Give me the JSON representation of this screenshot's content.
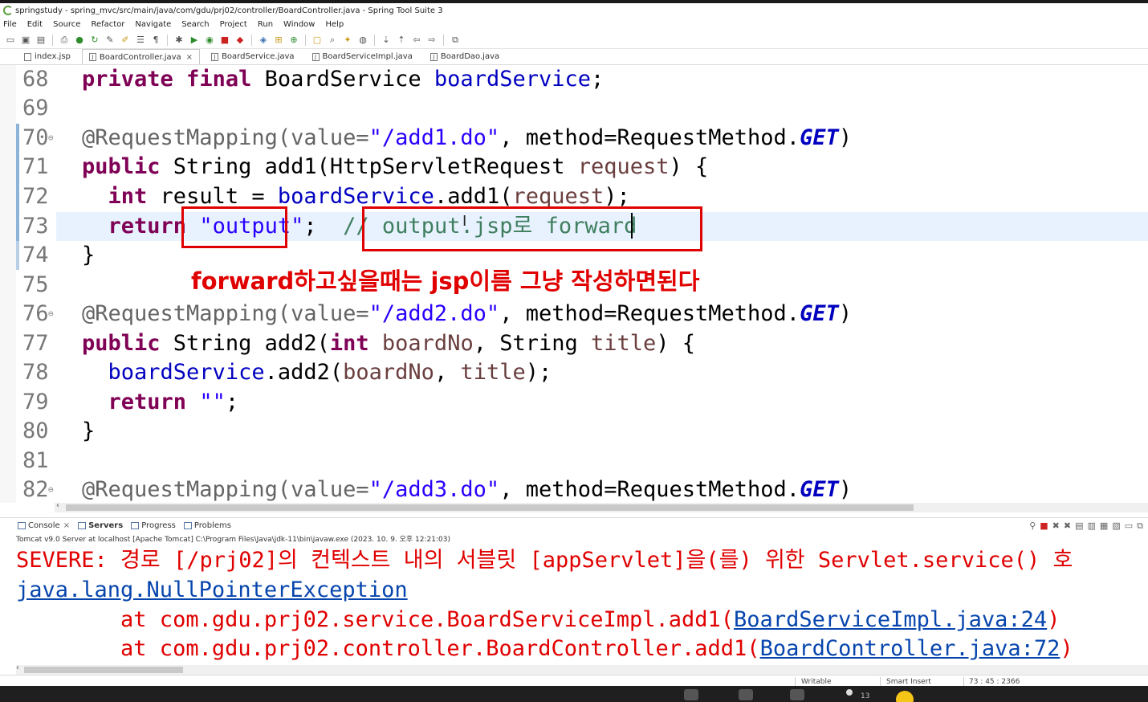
{
  "window": {
    "title": "springstudy - spring_mvc/src/main/java/com/gdu/prj02/controller/BoardController.java - Spring Tool Suite 3"
  },
  "menu": [
    "File",
    "Edit",
    "Source",
    "Refactor",
    "Navigate",
    "Search",
    "Project",
    "Run",
    "Window",
    "Help"
  ],
  "editor_tabs": [
    {
      "label": "index.jsp",
      "active": false
    },
    {
      "label": "BoardController.java",
      "active": true,
      "close": "×"
    },
    {
      "label": "BoardService.java",
      "active": false
    },
    {
      "label": "BoardServiceImpl.java",
      "active": false
    },
    {
      "label": "BoardDao.java",
      "active": false
    }
  ],
  "code_lines": [
    {
      "no": "68",
      "parts": [
        [
          "kw",
          "private"
        ],
        [
          "",
          "",
          " "
        ],
        [
          "kw",
          "final"
        ],
        [
          "",
          "",
          " "
        ]
      ]
    },
    {
      "no": "69"
    },
    {
      "no": "70"
    },
    {
      "no": "71"
    },
    {
      "no": "72"
    },
    {
      "no": "73"
    },
    {
      "no": "74"
    },
    {
      "no": "75"
    },
    {
      "no": "76"
    },
    {
      "no": "77"
    },
    {
      "no": "78"
    },
    {
      "no": "79"
    },
    {
      "no": "80"
    },
    {
      "no": "81"
    },
    {
      "no": "82"
    }
  ],
  "code": {
    "l68": {
      "a": "private",
      "b": "final",
      "c": " BoardService ",
      "d": "boardService",
      "e": ";"
    },
    "l70": {
      "a": "@RequestMapping(value=",
      "b": "\"/add1.do\"",
      "c": ", method=RequestMethod.",
      "d": "GET",
      "e": ")"
    },
    "l71": {
      "a": "public",
      "b": " String add1(HttpServletRequest ",
      "c": "request",
      "d": ") {"
    },
    "l72": {
      "a": "int",
      "b": " result = ",
      "c": "boardService",
      "d": ".add1(",
      "e": "request",
      "f": ");"
    },
    "l73": {
      "a": "return",
      "b": "\"output\"",
      "c": ";  ",
      "d": "// output.jsp로 forward"
    },
    "l74": {
      "a": "}"
    },
    "l76": {
      "a": "@RequestMapping(value=",
      "b": "\"/add2.do\"",
      "c": ", method=RequestMethod.",
      "d": "GET",
      "e": ")"
    },
    "l77": {
      "a": "public",
      "b": " String add2(",
      "c": "int",
      "d": " boardNo",
      "e": ", String ",
      "f": "title",
      "g": ") {"
    },
    "l78": {
      "a": "boardService",
      "b": ".add2(",
      "c": "boardNo",
      "d": ", ",
      "e": "title",
      "f": ");"
    },
    "l79": {
      "a": "return",
      "b": "\"\"",
      "c": ";"
    },
    "l80": {
      "a": "}"
    },
    "l82": {
      "a": "@RequestMapping(value=",
      "b": "\"/add3.do\"",
      "c": ", method=RequestMethod.",
      "d": "GET",
      "e": ")"
    }
  },
  "annotation_note": "forward하고싶을때는  jsp이름 그냥 작성하면된다",
  "bottom_tabs": [
    {
      "label": "Console",
      "close": "×"
    },
    {
      "label": "Servers"
    },
    {
      "label": "Progress"
    },
    {
      "label": "Problems"
    }
  ],
  "console": {
    "info": "Tomcat v9.0 Server at localhost [Apache Tomcat] C:\\Program Files\\Java\\jdk-11\\bin\\javaw.exe  (2023. 10. 9. 오후 12:21:03)",
    "line1": "SEVERE: 경로 [/prj02]의 컨텍스트 내의 서블릿 [appServlet]을(를) 위한 Servlet.service() 호",
    "line2": "java.lang.NullPointerException",
    "line3_pre": "        at com.gdu.prj02.service.BoardServiceImpl.add1(",
    "line3_link": "BoardServiceImpl.java:24",
    "line3_post": ")",
    "line4_pre": "        at com.gdu.prj02.controller.BoardController.add1(",
    "line4_link": "BoardController.java:72",
    "line4_post": ")"
  },
  "status": {
    "writable": "Writable",
    "insert": "Smart Insert",
    "position": "73 : 45 : 2366"
  },
  "taskbar": {
    "badge": "13"
  },
  "colors": {
    "highlight_red": "#e00000",
    "keyword": "#7f0055",
    "field": "#0000c0",
    "string": "#2a00ff",
    "comment": "#3f7f5f"
  }
}
